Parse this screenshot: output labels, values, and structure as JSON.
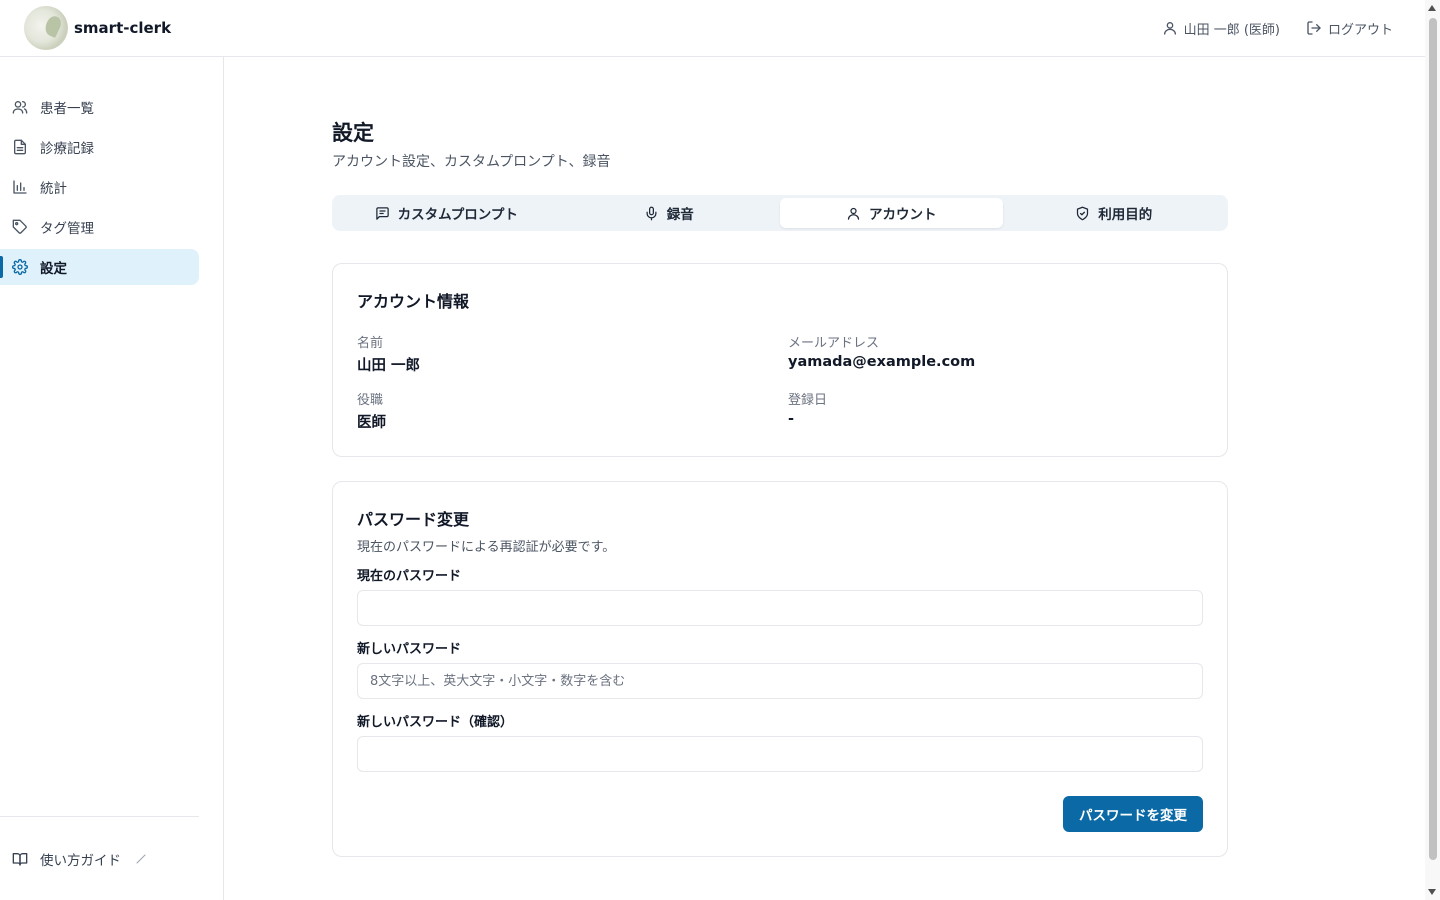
{
  "app": {
    "brand": "smart-clerk"
  },
  "header": {
    "user_label": "山田 一郎 (医師)",
    "logout_label": "ログアウト"
  },
  "sidebar": {
    "items": [
      {
        "label": "患者一覧",
        "icon": "users-icon"
      },
      {
        "label": "診療記録",
        "icon": "file-text-icon"
      },
      {
        "label": "統計",
        "icon": "bar-chart-icon"
      },
      {
        "label": "タグ管理",
        "icon": "tag-icon"
      },
      {
        "label": "設定",
        "icon": "gear-icon",
        "active": true
      }
    ],
    "guide_label": "使い方ガイド"
  },
  "page": {
    "title": "設定",
    "subtitle": "アカウント設定、カスタムプロンプト、録音"
  },
  "tabs": [
    {
      "label": "カスタムプロンプト",
      "icon": "message-square-icon"
    },
    {
      "label": "録音",
      "icon": "mic-icon"
    },
    {
      "label": "アカウント",
      "icon": "user-icon",
      "active": true
    },
    {
      "label": "利用目的",
      "icon": "shield-check-icon"
    }
  ],
  "account": {
    "title": "アカウント情報",
    "name_label": "名前",
    "name_value": "山田 一郎",
    "email_label": "メールアドレス",
    "email_value": "yamada@example.com",
    "role_label": "役職",
    "role_value": "医師",
    "registered_label": "登録日",
    "registered_value": "-"
  },
  "password": {
    "title": "パスワード変更",
    "description": "現在のパスワードによる再認証が必要です。",
    "current_label": "現在のパスワード",
    "current_value": "",
    "new_label": "新しいパスワード",
    "new_placeholder": "8文字以上、英大文字・小文字・数字を含む",
    "confirm_label": "新しいパスワード（確認）",
    "confirm_value": "",
    "submit_label": "パスワードを変更"
  },
  "colors": {
    "accent": "#0b6aa6",
    "active_nav_bg": "#dff1fb",
    "tabs_bg": "#eef3f8",
    "border": "#e5e7eb"
  }
}
